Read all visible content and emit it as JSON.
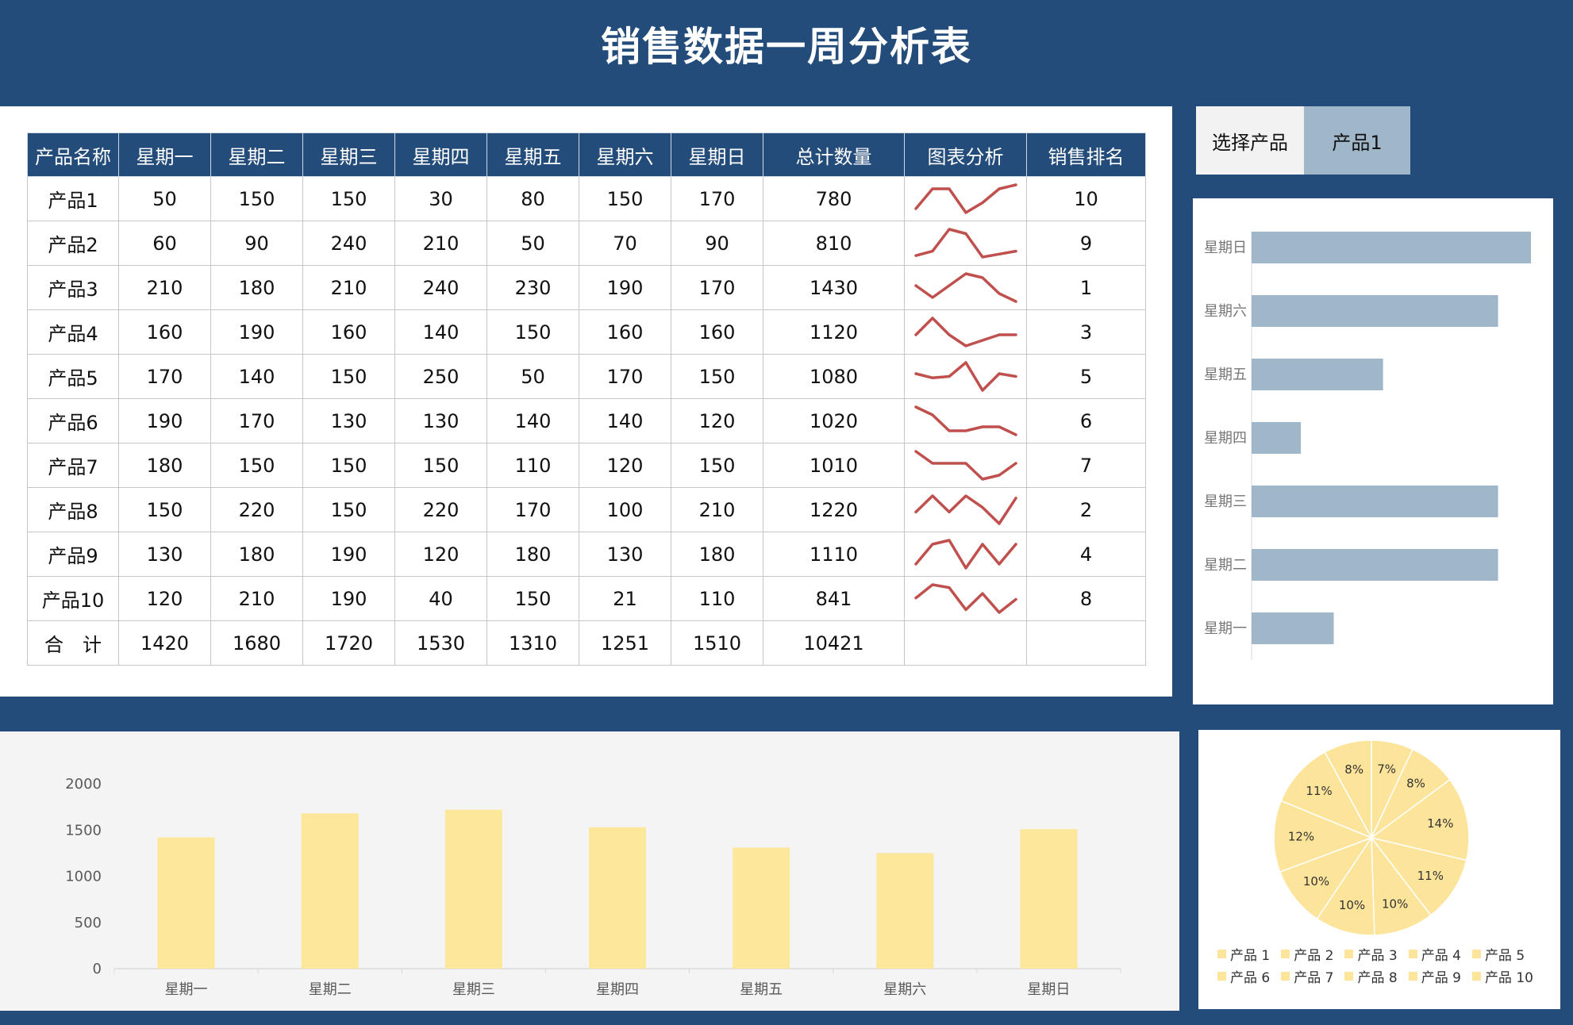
{
  "title": "销售数据一周分析表",
  "table": {
    "headers": [
      "产品名称",
      "星期一",
      "星期二",
      "星期三",
      "星期四",
      "星期五",
      "星期六",
      "星期日",
      "总计数量",
      "图表分析",
      "销售排名"
    ],
    "rows": [
      {
        "name": "产品1",
        "values": [
          50,
          150,
          150,
          30,
          80,
          150,
          170
        ],
        "total": 780,
        "rank": 10
      },
      {
        "name": "产品2",
        "values": [
          60,
          90,
          240,
          210,
          50,
          70,
          90
        ],
        "total": 810,
        "rank": 9
      },
      {
        "name": "产品3",
        "values": [
          210,
          180,
          210,
          240,
          230,
          190,
          170
        ],
        "total": 1430,
        "rank": 1
      },
      {
        "name": "产品4",
        "values": [
          160,
          190,
          160,
          140,
          150,
          160,
          160
        ],
        "total": 1120,
        "rank": 3
      },
      {
        "name": "产品5",
        "values": [
          170,
          140,
          150,
          250,
          50,
          170,
          150
        ],
        "total": 1080,
        "rank": 5
      },
      {
        "name": "产品6",
        "values": [
          190,
          170,
          130,
          130,
          140,
          140,
          120
        ],
        "total": 1020,
        "rank": 6
      },
      {
        "name": "产品7",
        "values": [
          180,
          150,
          150,
          150,
          110,
          120,
          150
        ],
        "total": 1010,
        "rank": 7
      },
      {
        "name": "产品8",
        "values": [
          150,
          220,
          150,
          220,
          170,
          100,
          210
        ],
        "total": 1220,
        "rank": 2
      },
      {
        "name": "产品9",
        "values": [
          130,
          180,
          190,
          120,
          180,
          130,
          180
        ],
        "total": 1110,
        "rank": 4
      },
      {
        "name": "产品10",
        "values": [
          120,
          210,
          190,
          40,
          150,
          21,
          110
        ],
        "total": 841,
        "rank": 8
      }
    ],
    "sum_row": {
      "name": "合　计",
      "values": [
        1420,
        1680,
        1720,
        1530,
        1310,
        1251,
        1510
      ],
      "total": 10421
    }
  },
  "sparkline_color": "#c0504d",
  "selector": {
    "label": "选择产品",
    "value": "产品1"
  },
  "chart_data": [
    {
      "type": "bar",
      "orientation": "horizontal",
      "categories": [
        "星期日",
        "星期六",
        "星期五",
        "星期四",
        "星期三",
        "星期二",
        "星期一"
      ],
      "values": [
        170,
        150,
        80,
        30,
        150,
        150,
        50
      ],
      "bar_color": "#a0b7c9",
      "xlim": [
        0,
        170
      ]
    },
    {
      "type": "bar",
      "categories": [
        "星期一",
        "星期二",
        "星期三",
        "星期四",
        "星期五",
        "星期六",
        "星期日"
      ],
      "values": [
        1420,
        1680,
        1720,
        1530,
        1310,
        1251,
        1510
      ],
      "ylim": [
        0,
        2000
      ],
      "yticks": [
        0,
        500,
        1000,
        1500,
        2000
      ],
      "bar_color": "#fce79a",
      "grid": false
    },
    {
      "type": "pie",
      "labels": [
        "产品 1",
        "产品 2",
        "产品 3",
        "产品 4",
        "产品 5",
        "产品 6",
        "产品 7",
        "产品 8",
        "产品 9",
        "产品 10"
      ],
      "values": [
        7,
        8,
        14,
        11,
        10,
        10,
        10,
        12,
        11,
        8
      ],
      "slice_labels": [
        "7%",
        "8%",
        "14%",
        "11%",
        "10%",
        "10%",
        "10%",
        "12%",
        "11%",
        "8%"
      ],
      "slice_color": "#fce49a",
      "legend_position": "bottom"
    }
  ]
}
